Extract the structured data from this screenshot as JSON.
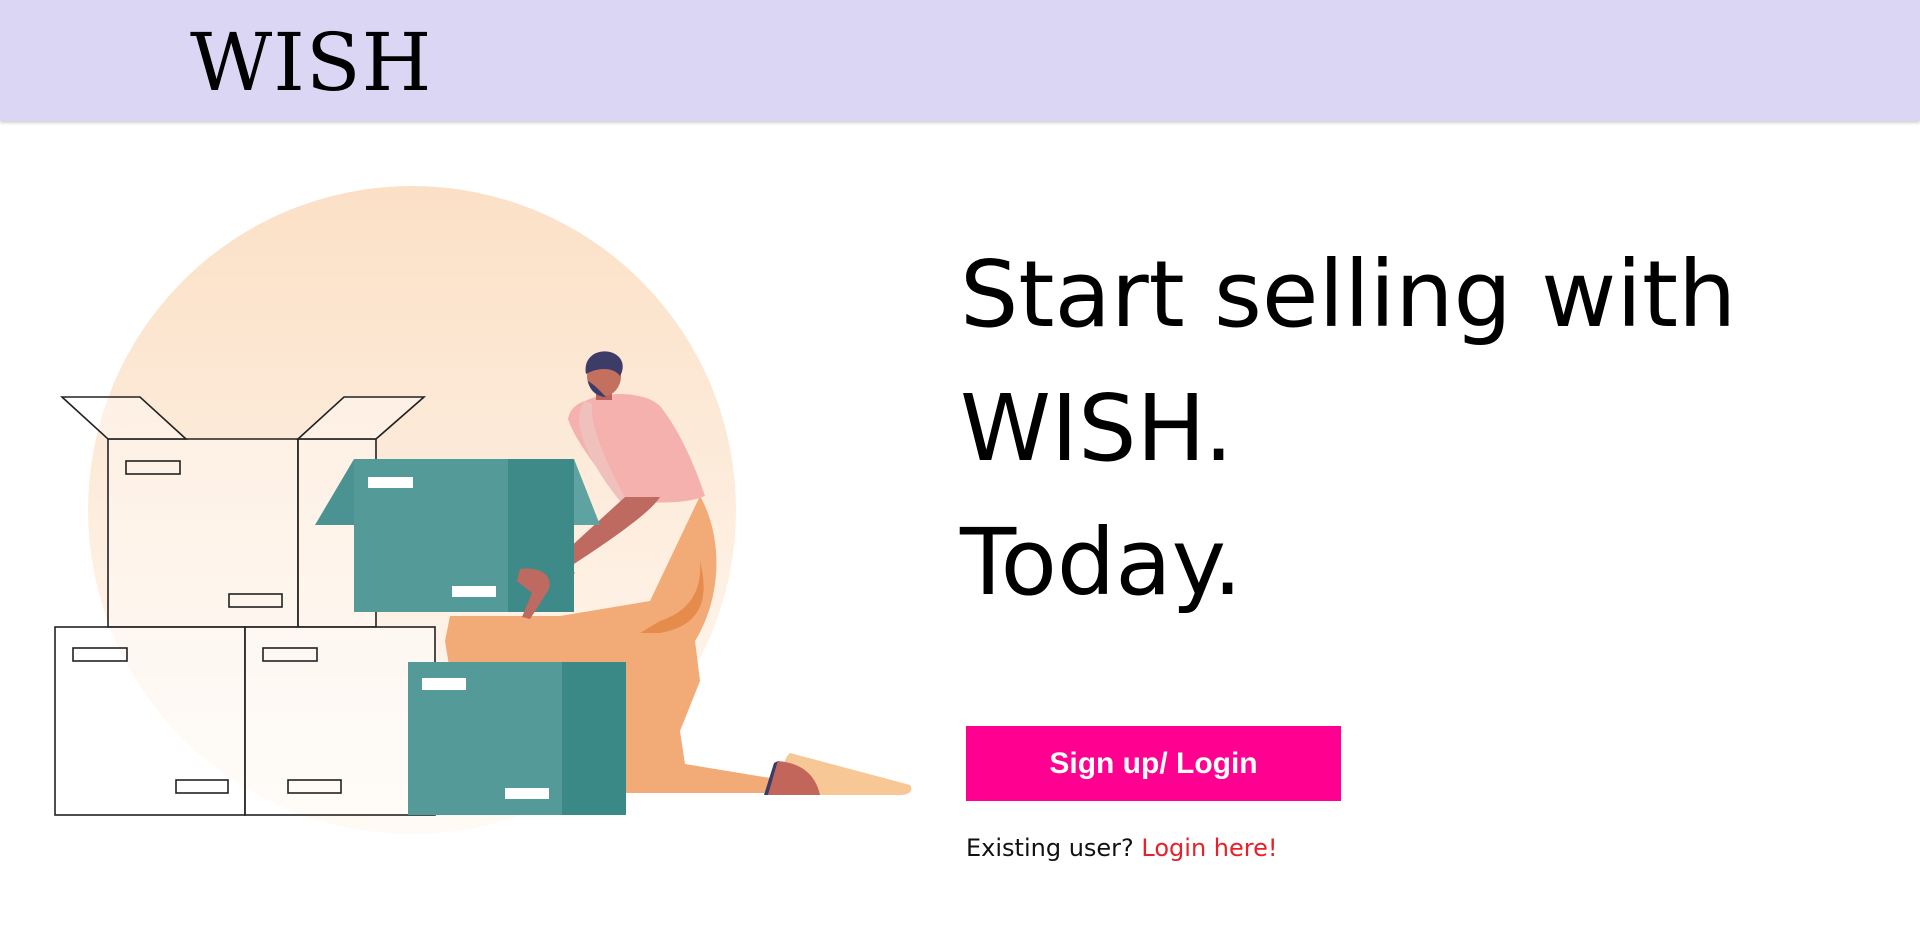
{
  "header": {
    "logo": "WISH",
    "background_color": "#dad6f4"
  },
  "hero": {
    "headline_lines": [
      "Start selling with",
      "WISH.",
      "Today."
    ],
    "illustration": "person-packing-boxes-illustration"
  },
  "cta": {
    "label": "Sign up/ Login",
    "color": "#ff0090"
  },
  "login_prompt": {
    "text": "Existing user?",
    "link_label": "Login here!",
    "link_color": "#e8202a"
  }
}
